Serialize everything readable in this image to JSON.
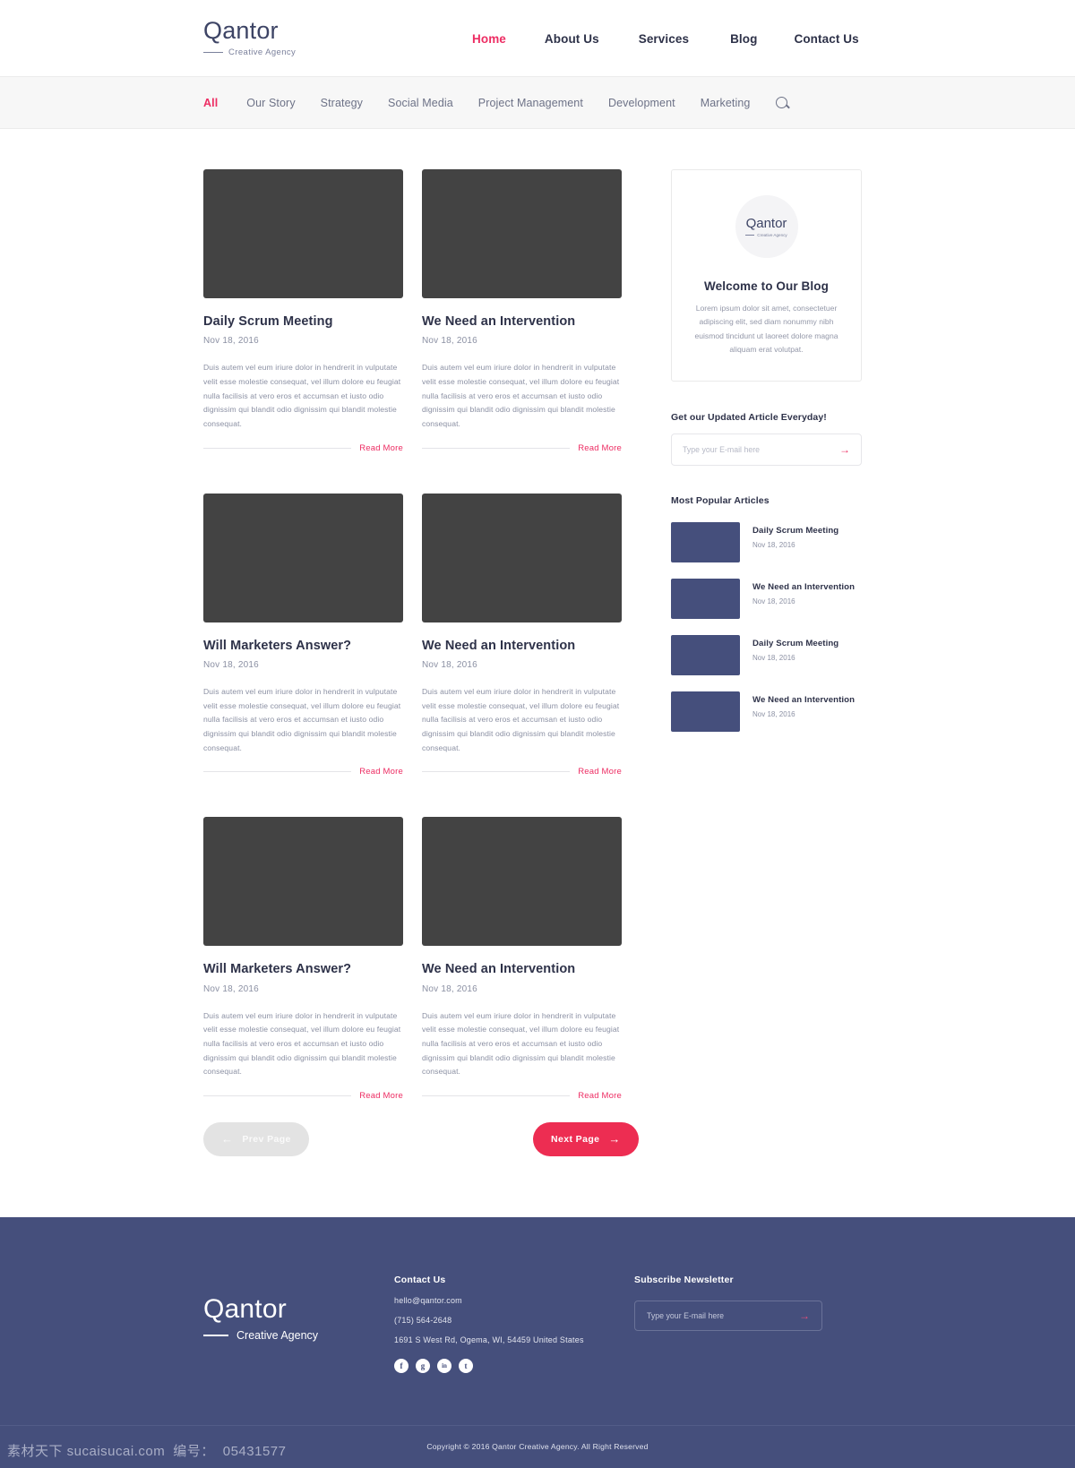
{
  "brand": {
    "name": "Qantor",
    "tagline": "Creative Agency"
  },
  "nav": {
    "items": [
      {
        "label": "Home",
        "active": true
      },
      {
        "label": "About Us",
        "active": false
      },
      {
        "label": "Services",
        "active": false
      },
      {
        "label": "Blog",
        "active": false
      },
      {
        "label": "Contact Us",
        "active": false
      }
    ]
  },
  "filters": {
    "items": [
      {
        "label": "All",
        "active": true
      },
      {
        "label": "Our Story",
        "active": false
      },
      {
        "label": "Strategy",
        "active": false
      },
      {
        "label": "Social Media",
        "active": false
      },
      {
        "label": "Project Management",
        "active": false
      },
      {
        "label": "Development",
        "active": false
      },
      {
        "label": "Marketing",
        "active": false
      }
    ],
    "search_icon": "search-icon"
  },
  "posts": [
    {
      "title": "Daily Scrum Meeting",
      "date": "Nov 18, 2016",
      "excerpt": "Duis autem vel eum iriure dolor in hendrerit in vulputate velit esse molestie consequat, vel illum dolore eu feugiat nulla facilisis at vero eros et accumsan et iusto odio dignissim qui blandit odio dignissim qui blandit molestie consequat.",
      "read_more": "Read More"
    },
    {
      "title": "We Need an Intervention",
      "date": "Nov 18, 2016",
      "excerpt": "Duis autem vel eum iriure dolor in hendrerit in vulputate velit esse molestie consequat, vel illum dolore eu feugiat nulla facilisis at vero eros et accumsan et iusto odio dignissim qui blandit odio dignissim qui blandit molestie consequat.",
      "read_more": "Read More"
    },
    {
      "title": "Will Marketers Answer?",
      "date": "Nov 18, 2016",
      "excerpt": "Duis autem vel eum iriure dolor in hendrerit in vulputate velit esse molestie consequat, vel illum dolore eu feugiat nulla facilisis at vero eros et accumsan et iusto odio dignissim qui blandit odio dignissim qui blandit molestie consequat.",
      "read_more": "Read More"
    },
    {
      "title": "We Need an Intervention",
      "date": "Nov 18, 2016",
      "excerpt": "Duis autem vel eum iriure dolor in hendrerit in vulputate velit esse molestie consequat, vel illum dolore eu feugiat nulla facilisis at vero eros et accumsan et iusto odio dignissim qui blandit odio dignissim qui blandit molestie consequat.",
      "read_more": "Read More"
    },
    {
      "title": "Will Marketers Answer?",
      "date": "Nov 18, 2016",
      "excerpt": "Duis autem vel eum iriure dolor in hendrerit in vulputate velit esse molestie consequat, vel illum dolore eu feugiat nulla facilisis at vero eros et accumsan et iusto odio dignissim qui blandit odio dignissim qui blandit molestie consequat.",
      "read_more": "Read More"
    },
    {
      "title": "We Need an Intervention",
      "date": "Nov 18, 2016",
      "excerpt": "Duis autem vel eum iriure dolor in hendrerit in vulputate velit esse molestie consequat, vel illum dolore eu feugiat nulla facilisis at vero eros et accumsan et iusto odio dignissim qui blandit odio dignissim qui blandit molestie consequat.",
      "read_more": "Read More"
    }
  ],
  "pagination": {
    "prev_label": "Prev Page",
    "next_label": "Next Page",
    "prev_arrow": "←",
    "next_arrow": "→"
  },
  "sidebar": {
    "welcome": {
      "title": "Welcome to Our Blog",
      "text": "Lorem ipsum dolor sit amet, consectetuer adipiscing elit, sed diam nonummy nibh euismod tincidunt ut laoreet dolore magna aliquam erat volutpat."
    },
    "subscribe": {
      "heading": "Get our Updated Article Everyday!",
      "placeholder": "Type your E-mail here",
      "value": "",
      "submit_arrow": "→"
    },
    "popular": {
      "heading": "Most Popular Articles",
      "items": [
        {
          "title": "Daily Scrum Meeting",
          "date": "Nov 18, 2016"
        },
        {
          "title": "We Need an Intervention",
          "date": "Nov 18, 2016"
        },
        {
          "title": "Daily Scrum Meeting",
          "date": "Nov 18, 2016"
        },
        {
          "title": "We Need an Intervention",
          "date": "Nov 18, 2016"
        }
      ]
    }
  },
  "footer": {
    "contact": {
      "heading": "Contact Us",
      "email": "hello@qantor.com",
      "phone": "(715) 564-2648",
      "address": "1691 S West Rd, Ogema, WI, 54459 United States"
    },
    "socials": [
      {
        "name": "facebook-icon",
        "glyph": "f"
      },
      {
        "name": "google-plus-icon",
        "glyph": "g"
      },
      {
        "name": "linkedin-icon",
        "glyph": "in"
      },
      {
        "name": "twitter-icon",
        "glyph": "t"
      }
    ],
    "newsletter": {
      "heading": "Subscribe Newsletter",
      "placeholder": "Type your E-mail here",
      "value": "",
      "submit_arrow": "→"
    },
    "copyright": "Copyright  © 2016 Qantor Creative Agency. All Right Reserved"
  },
  "watermark": {
    "site": "素材天下 sucaisucai.com",
    "id_label": "编号：",
    "id_value": "05431577"
  },
  "colors": {
    "accent_pink": "#ed2d63",
    "footer_blue": "#454f7c",
    "card_dark": "#434343",
    "text_dark": "#2e3249",
    "text_muted": "#8b90a3"
  }
}
